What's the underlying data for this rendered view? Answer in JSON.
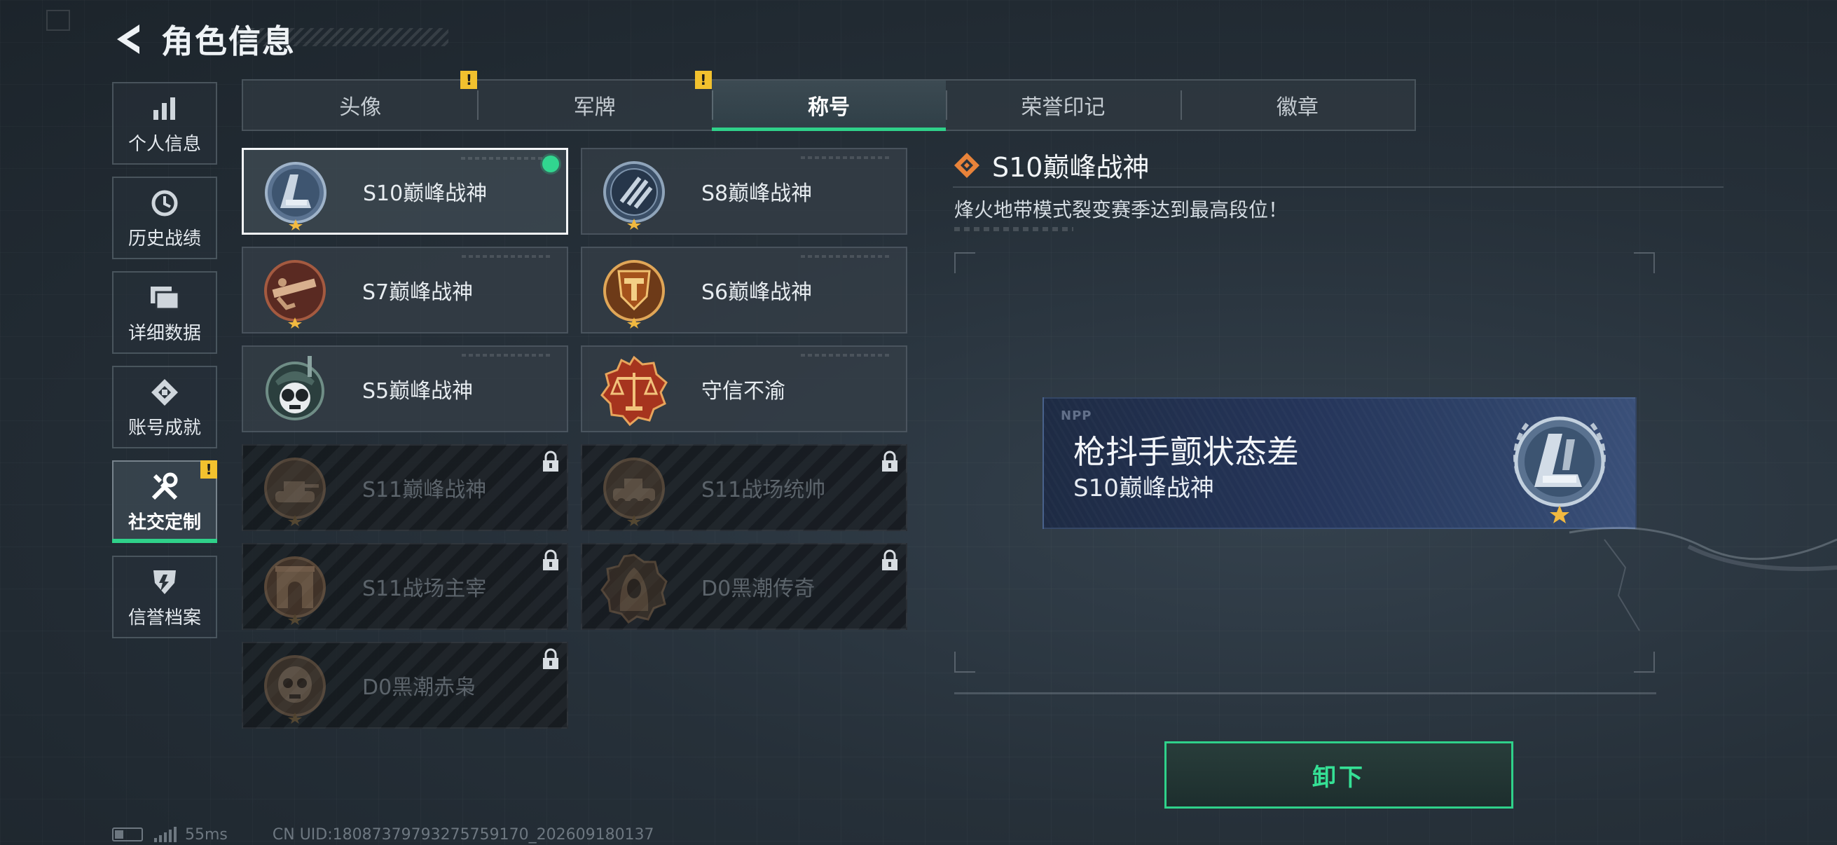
{
  "header": {
    "title": "角色信息"
  },
  "sidebar": {
    "items": [
      {
        "label": "个人信息",
        "icon": "bar-chart-icon"
      },
      {
        "label": "历史战绩",
        "icon": "history-clock-icon"
      },
      {
        "label": "详细数据",
        "icon": "folder-icon"
      },
      {
        "label": "账号成就",
        "icon": "achievement-icon"
      },
      {
        "label": "社交定制",
        "icon": "tools-icon",
        "active": true,
        "warning": "!"
      },
      {
        "label": "信誉档案",
        "icon": "credit-shield-icon"
      }
    ]
  },
  "tabs": [
    {
      "label": "头像",
      "warning": "!"
    },
    {
      "label": "军牌",
      "warning": "!"
    },
    {
      "label": "称号",
      "active": true
    },
    {
      "label": "荣誉印记"
    },
    {
      "label": "徽章"
    }
  ],
  "titles": [
    {
      "name": "S10巅峰战神",
      "selected": true,
      "equipped": true,
      "locked": false
    },
    {
      "name": "S8巅峰战神",
      "locked": false
    },
    {
      "name": "S7巅峰战神",
      "locked": false
    },
    {
      "name": "S6巅峰战神",
      "locked": false
    },
    {
      "name": "S5巅峰战神",
      "locked": false
    },
    {
      "name": "守信不渝",
      "locked": false
    },
    {
      "name": "S11巅峰战神",
      "locked": true
    },
    {
      "name": "S11战场统帅",
      "locked": true
    },
    {
      "name": "S11战场主宰",
      "locked": true
    },
    {
      "name": "D0黑潮传奇",
      "locked": true
    },
    {
      "name": "D0黑潮赤枭",
      "locked": true
    }
  ],
  "detail": {
    "title": "S10巅峰战神",
    "description": "烽火地带模式裂变赛季达到最高段位！",
    "banner": {
      "logo": "NPP",
      "nickname": "枪抖手颤状态差",
      "title": "S10巅峰战神"
    },
    "action_label": "卸下"
  },
  "status": {
    "ping": "55ms",
    "uid": "CN UID:18087379793275759170_202609180137"
  },
  "colors": {
    "accent": "#2fd18a",
    "warning": "#f2c12e",
    "lock": "#d8dde2"
  }
}
